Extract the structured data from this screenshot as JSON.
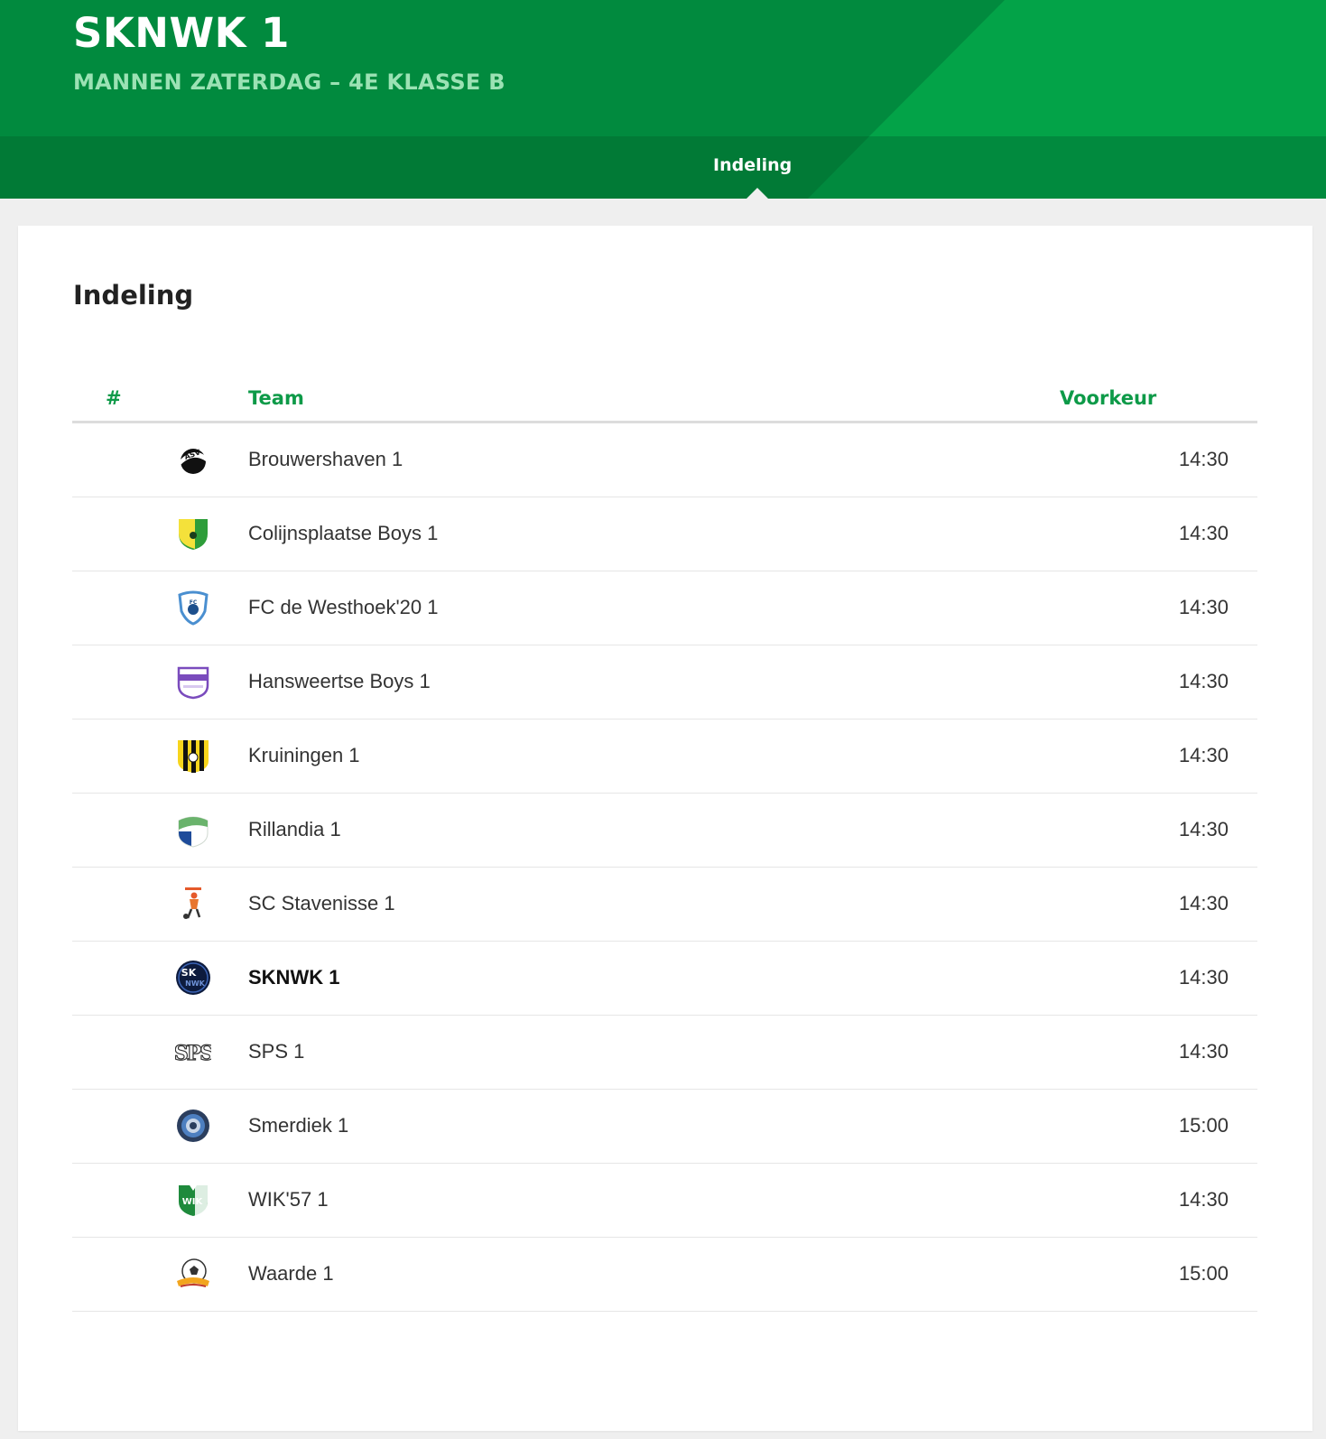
{
  "header": {
    "title": "SKNWK 1",
    "competition": "MANNEN ZATERDAG – 4E KLASSE B",
    "tab_label": "Indeling"
  },
  "section": {
    "title": "Indeling"
  },
  "table": {
    "columns": {
      "num": "#",
      "team": "Team",
      "preference": "Voorkeur"
    },
    "rows": [
      {
        "name": "Brouwershaven 1",
        "time": "14:30",
        "logo": "asv-ball-icon"
      },
      {
        "name": "Colijnsplaatse Boys 1",
        "time": "14:30",
        "logo": "yellow-green-shield-icon"
      },
      {
        "name": "FC de Westhoek'20 1",
        "time": "14:30",
        "logo": "blue-shield-icon"
      },
      {
        "name": "Hansweertse Boys 1",
        "time": "14:30",
        "logo": "purple-white-crest-icon"
      },
      {
        "name": "Kruiningen 1",
        "time": "14:30",
        "logo": "yellow-black-stripes-icon"
      },
      {
        "name": "Rillandia 1",
        "time": "14:30",
        "logo": "green-blue-shield-icon"
      },
      {
        "name": "SC Stavenisse 1",
        "time": "14:30",
        "logo": "orange-player-icon"
      },
      {
        "name": "SKNWK 1",
        "time": "14:30",
        "logo": "sknwk-round-icon",
        "highlight": true
      },
      {
        "name": "SPS 1",
        "time": "14:30",
        "logo": "sps-letters-icon"
      },
      {
        "name": "Smerdiek 1",
        "time": "15:00",
        "logo": "round-blue-seal-icon"
      },
      {
        "name": "WIK'57 1",
        "time": "14:30",
        "logo": "green-wik-shield-icon"
      },
      {
        "name": "Waarde 1",
        "time": "15:00",
        "logo": "ball-banner-icon"
      }
    ]
  },
  "colors": {
    "brand_green": "#018a3e",
    "light_green": "#03a348",
    "header_accent": "#0d9a48",
    "subtitle": "#9be2b4"
  }
}
